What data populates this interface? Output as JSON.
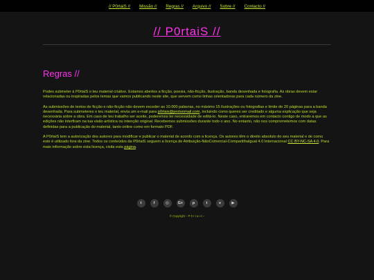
{
  "nav": {
    "items": [
      "// P0rtaiS //",
      "Missão //",
      "Regras //",
      "Arquivo //",
      "Sobre //",
      "Contacto //"
    ]
  },
  "site_title": "// P0rtaiS //",
  "page_heading": "Regras //",
  "content": {
    "p1": "Podes submeter à P0rtaiS o teu material criativo. Estamos abertos a ficção, poesia, não-ficção, ilustração, banda desenhada e fotografia. As obras devem estar relacionadas ou inspiradas pelos temas que vamos publicando neste site, que servem como linhas orientadoras para cada número da zine.",
    "p2_before": "As submissões de textos de ficção e não-ficção não devem exceder as 10.000 palavras, no máximo 15 ilustrações ou fotografias e limite de 20 páginas para a banda desenhada. Para submeteres o teu material, envia um e-mail para ",
    "p2_email": "p0rtais@protonmail.com",
    "p2_after": ", incluindo como queres ser creditado e alguma explicação que seja necessária sobre a obra. Em caso de teu trabalho ser aceite, poderemos ter necessidade de editá-lo. Neste caso, entraremos em contacto contigo de modo a que as edições não interfiram na tua visão artística ou intenção original. Recebemos submissões durante todo o ano. No entanto, não nos comprometemos com datas definidas para a publicação do material, tanto online como em formato PDF.",
    "p3_before": "A P0rtaiS tem a autorização dos autores para modificar e publicar o material de acordo com a licença. Os autores têm o direito absoluto do seu material e de como este é utilizado fora da zine. Todos os conteúdos da P0rtaiS seguem a licença de Atribuição-NãoComercial-CompartilhaIgual 4.0 Internacional ",
    "p3_license": "CC BY-NC-SA 4.0",
    "p3_middle": ". Para mais informação sobre esta licença, visita esta ",
    "p3_link": "página",
    "p3_end": "."
  },
  "social_icons": [
    {
      "name": "twitter-icon",
      "glyph": "t"
    },
    {
      "name": "facebook-icon",
      "glyph": "f"
    },
    {
      "name": "instagram-icon",
      "glyph": "◎"
    },
    {
      "name": "google-plus-icon",
      "glyph": "G+"
    },
    {
      "name": "pinterest-icon",
      "glyph": "p"
    },
    {
      "name": "tumblr-icon",
      "glyph": "t"
    },
    {
      "name": "vimeo-icon",
      "glyph": "v"
    },
    {
      "name": "youtube-icon",
      "glyph": "▶"
    }
  ],
  "copyright": "© Copyright – P 0 r t a i s –",
  "colors": {
    "background": "#141414",
    "nav_background": "#000000",
    "accent_magenta": "#ff33ee",
    "text_green": "#b8e02a"
  }
}
